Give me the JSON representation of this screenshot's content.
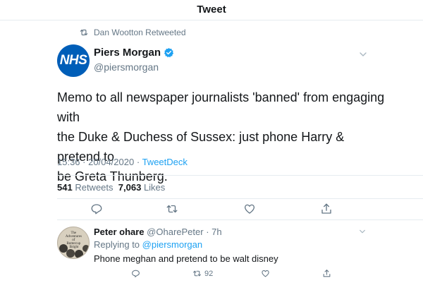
{
  "header": {
    "title": "Tweet"
  },
  "retweet_notice": {
    "text": "Dan Wootton Retweeted"
  },
  "tweet": {
    "avatar_text": "NHS",
    "author_name": "Piers Morgan",
    "author_handle": "@piersmorgan",
    "text_lines": [
      "Memo to all newspaper journalists 'banned' from engaging with",
      "the Duke & Duchess of Sussex: just phone Harry & pretend to",
      "be Greta Thunberg."
    ],
    "time": "15:36",
    "date": "20/04/2020",
    "separator": "·",
    "source": "TweetDeck",
    "retweet_count": "541",
    "retweet_label": "Retweets",
    "like_count": "7,063",
    "like_label": "Likes"
  },
  "reply": {
    "author_name": "Peter ohare",
    "author_handle": "@OharePeter",
    "time_meta": "· 7h",
    "replying_prefix": "Replying to",
    "replying_to": "@piersmorgan",
    "text": "Phone meghan and pretend to be walt disney",
    "retweet_count_display": "92",
    "avatar_lines": [
      "The",
      "Adventures",
      "of",
      "Buttercup",
      "Bright"
    ]
  },
  "colors": {
    "accent": "#1da1f2",
    "muted": "#657786",
    "nhs_blue": "#005eb8",
    "divider": "#e6ecf0"
  },
  "icons": {
    "retweet_notice": "retweet-icon",
    "verified": "verified-badge-icon",
    "caret": "chevron-down-icon",
    "reply": "reply-icon",
    "retweet": "retweet-icon",
    "like": "heart-icon",
    "share": "share-icon"
  }
}
